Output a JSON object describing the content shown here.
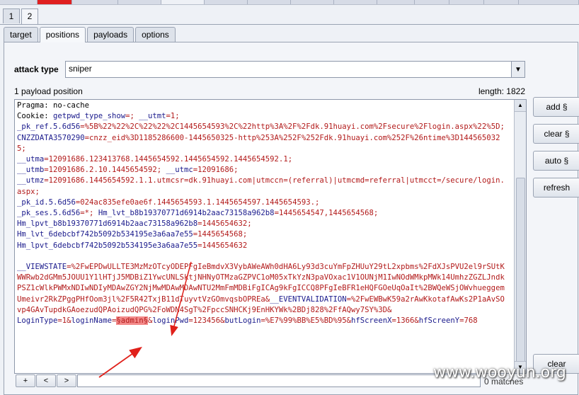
{
  "outer_tabs": [
    "1",
    "2"
  ],
  "tabs": [
    "target",
    "positions",
    "payloads",
    "options"
  ],
  "attack_type": {
    "label": "attack type",
    "value": "sniper"
  },
  "payload_position_count": "1 payload position",
  "length_label": "length: 1822",
  "request_lines": [
    [
      {
        "t": "Pragma: no-cache",
        "c": "k"
      }
    ],
    [
      {
        "t": "Cookie: ",
        "c": "k"
      },
      {
        "t": "getpwd_type_show",
        "c": "b"
      },
      {
        "t": "=; ",
        "c": "r"
      },
      {
        "t": "__utmt",
        "c": "b"
      },
      {
        "t": "=1;",
        "c": "r"
      }
    ],
    [
      {
        "t": "_pk_ref.5.6d56",
        "c": "b"
      },
      {
        "t": "=%5B%22%22%2C%22%22%2C1445654593%2C%22http%3A%2F%2Fdk.91huayi.com%2Fsecure%2Flogin.aspx%22%5D;",
        "c": "r"
      }
    ],
    [
      {
        "t": "CNZZDATA3570290",
        "c": "b"
      },
      {
        "t": "=cnzz_eid%3D1185286600-1445650325-http%253A%252F%252Fdk.91huayi.com%252F%26ntime%3D1445650325;",
        "c": "r"
      }
    ],
    [
      {
        "t": "__utma",
        "c": "b"
      },
      {
        "t": "=12091686.123413768.1445654592.1445654592.1445654592.1;",
        "c": "r"
      }
    ],
    [
      {
        "t": "__utmb",
        "c": "b"
      },
      {
        "t": "=12091686.2.10.1445654592; ",
        "c": "r"
      },
      {
        "t": "__utmc",
        "c": "b"
      },
      {
        "t": "=12091686;",
        "c": "r"
      }
    ],
    [
      {
        "t": "__utmz",
        "c": "b"
      },
      {
        "t": "=12091686.1445654592.1.1.utmcsr=dk.91huayi.com|utmccn=(referral)|utmcmd=referral|utmcct=/secure/login.aspx;",
        "c": "r"
      }
    ],
    [
      {
        "t": "_pk_id.5.6d56",
        "c": "b"
      },
      {
        "t": "=024ac835efe0ae6f.1445654593.1.1445654597.1445654593.;",
        "c": "r"
      }
    ],
    [
      {
        "t": "_pk_ses.5.6d56",
        "c": "b"
      },
      {
        "t": "=*; ",
        "c": "r"
      },
      {
        "t": "Hm_lvt_b8b19370771d6914b2aac73158a962b8",
        "c": "b"
      },
      {
        "t": "=1445654547,1445654568;",
        "c": "r"
      }
    ],
    [
      {
        "t": "Hm_lpvt_b8b19370771d6914b2aac73158a962b8",
        "c": "b"
      },
      {
        "t": "=1445654632;",
        "c": "r"
      }
    ],
    [
      {
        "t": "Hm_lvt_6debcbf742b5092b534195e3a6aa7e55",
        "c": "b"
      },
      {
        "t": "=1445654568;",
        "c": "r"
      }
    ],
    [
      {
        "t": "Hm_lpvt_6debcbf742b5092b534195e3a6aa7e55",
        "c": "b"
      },
      {
        "t": "=1445654632",
        "c": "r"
      }
    ],
    [
      {
        "t": " ",
        "c": "k"
      }
    ],
    [
      {
        "t": "__VIEWSTATE",
        "c": "b"
      },
      {
        "t": "=%2FwEPDwULLTE3MzMzOTcyODEPFgIeBmdvX3VybAWeAWh0dHA6Ly93d3cuYmFpZHUuY29tL2xpbms%2FdXJsPVU2el9rSUtKWWRwb2dGMm5JOUU1Y1lHTjJ5MDBiZ1YwcUNLSktjNHNyOTMzaGZPVC1oM05xTkYzN3paVOxac1V1OUNjM1IwNOdWMkpMWk14UmhzZGZLJndkPSZ1cWlkPWMxNDIwNDIyMDAwZGY2NjMwMDAwMDAwNTU2MmFmMDBiFgICAg9kFgICCQ8PFgIeBFR1eHQFGOeUqOaIt%2BWQeWSjOWvhueggemUmeivr2RkZPggPHfOom3jl%2F5R42TxjB11dTuyvtVzGOmvqsbOPREa&",
        "c": "r"
      },
      {
        "t": "__EVENTVALIDATION",
        "c": "b"
      },
      {
        "t": "=%2FwEWBwK59a2rAwKkotafAwKs2P1aAvSOvp4GAvTupdkGAoezudQPAoizudQPG%2FoWDN4SgT%2FpccSNHCKj9EnHKYWk%2BDj828%2FfAQwy7SY%3D&",
        "c": "r"
      }
    ],
    [
      {
        "t": "LoginType",
        "c": "b"
      },
      {
        "t": "=1&",
        "c": "r"
      },
      {
        "t": "loginName",
        "c": "b"
      },
      {
        "t": "=",
        "c": "r"
      },
      {
        "t": "§admin§",
        "c": "sel"
      },
      {
        "t": "&",
        "c": "r"
      },
      {
        "t": "loginPwd",
        "c": "b"
      },
      {
        "t": "=123456&",
        "c": "r"
      },
      {
        "t": "butLogin",
        "c": "b"
      },
      {
        "t": "=%E7%99%BB%E5%BD%95&",
        "c": "r"
      },
      {
        "t": "hfScreenX",
        "c": "b"
      },
      {
        "t": "=1366&",
        "c": "r"
      },
      {
        "t": "hfScreenY",
        "c": "b"
      },
      {
        "t": "=768",
        "c": "r"
      }
    ]
  ],
  "side_buttons": {
    "add": "add §",
    "clear": "clear §",
    "auto": "auto §",
    "refresh": "refresh",
    "clear_bottom": "clear"
  },
  "search": {
    "plus": "+",
    "prev": "<",
    "next": ">",
    "matches": "0 matches"
  },
  "watermark": "www.wooyun.org",
  "colors": {
    "param_name": "#1a1a8c",
    "param_value": "#b21a1a",
    "payload_marker_bg": "#f38a8a",
    "annotation_arrow": "#e0201a"
  }
}
